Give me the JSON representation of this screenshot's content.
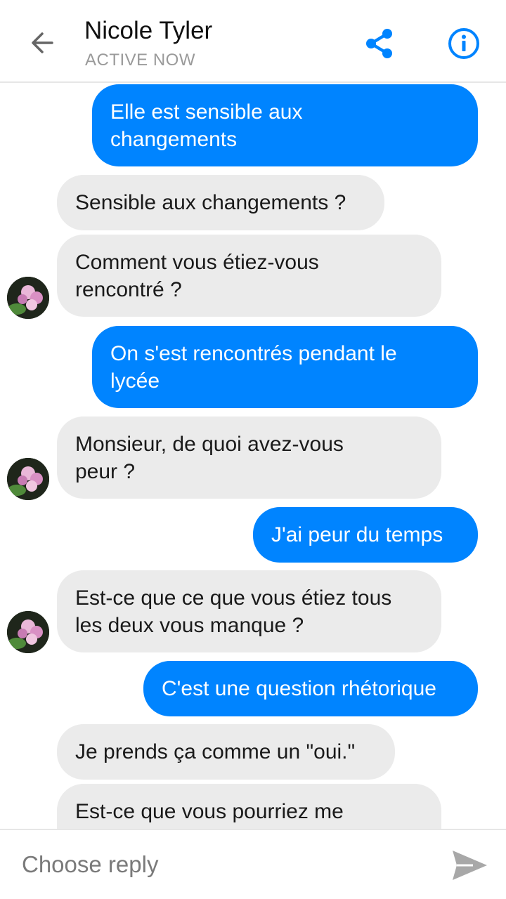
{
  "header": {
    "contact_name": "Nicole Tyler",
    "status": "ACTIVE NOW",
    "icons": {
      "back": "back-arrow-icon",
      "share": "share-icon",
      "info": "info-icon"
    }
  },
  "colors": {
    "outgoing": "#0084ff",
    "incoming": "#ebebeb",
    "accent": "#0084ff"
  },
  "messages": [
    {
      "direction": "outgoing",
      "text": "Elle est sensible aux\nchangements"
    },
    {
      "direction": "incoming",
      "text": "Sensible aux changements ?"
    },
    {
      "direction": "incoming",
      "text": "Comment vous étiez-vous\nrencontré ?"
    },
    {
      "direction": "outgoing",
      "text": "On s'est rencontrés pendant le\nlycée"
    },
    {
      "direction": "incoming",
      "text": "Monsieur, de quoi avez-vous\npeur ?"
    },
    {
      "direction": "outgoing",
      "text": "J'ai peur du temps"
    },
    {
      "direction": "incoming",
      "text": "Est-ce que ce que vous étiez tous\nles deux vous manque ?"
    },
    {
      "direction": "outgoing",
      "text": "C'est une question rhétorique"
    },
    {
      "direction": "incoming",
      "text": "Je prends ça comme un \"oui.\""
    },
    {
      "direction": "incoming",
      "text": "Est-ce que vous pourriez me"
    }
  ],
  "composer": {
    "placeholder": "Choose reply",
    "send_icon": "send-icon"
  }
}
